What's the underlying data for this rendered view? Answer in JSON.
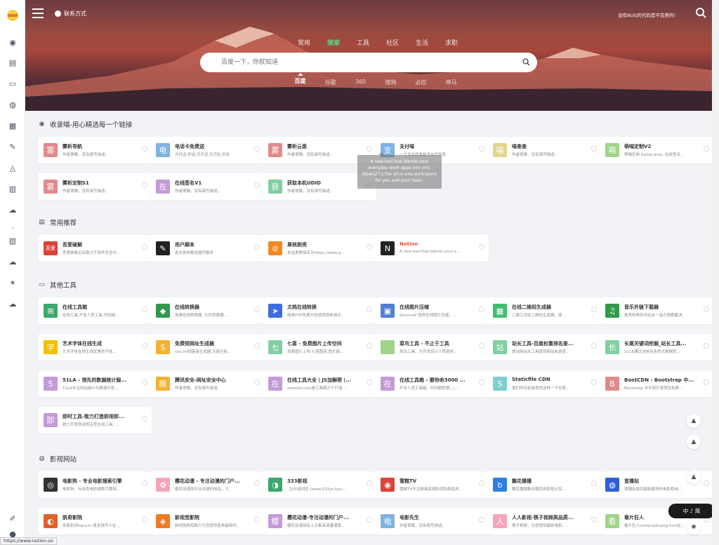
{
  "header": {
    "contact_label": "联系方式",
    "slogan": "没有BUG的代码是不完美的!",
    "search_tabs": [
      {
        "label": "常用",
        "active": false
      },
      {
        "label": "搜索",
        "active": true
      },
      {
        "label": "工具",
        "active": false
      },
      {
        "label": "社区",
        "active": false
      },
      {
        "label": "生活",
        "active": false
      },
      {
        "label": "求职",
        "active": false
      }
    ],
    "search_placeholder": "百度一下，你就知道",
    "engines": [
      {
        "label": "百度",
        "active": true
      },
      {
        "label": "谷歌",
        "active": false
      },
      {
        "label": "360",
        "active": false
      },
      {
        "label": "搜狗",
        "active": false
      },
      {
        "label": "必应",
        "active": false
      },
      {
        "label": "神马",
        "active": false
      }
    ]
  },
  "sections": [
    {
      "title": "收录喵-用心精选每一个链接",
      "icon": "eye-icon",
      "cards": [
        {
          "avatar": "雾",
          "color": "#e08a8a",
          "title": "雾析导航",
          "desc": "作者很懒，没有填写描述。"
        },
        {
          "avatar": "电",
          "color": "#7fb3e0",
          "title": "电话卡免费送",
          "desc": "次月返,秒返,月月返,次月反,秒反"
        },
        {
          "avatar": "雾",
          "color": "#e08a8a",
          "title": "雾析云盘",
          "desc": "作者很懒，没有填写描述。"
        },
        {
          "avatar": "支",
          "color": "#7fb3e0",
          "title": "支付喵",
          "desc": "一个专业的系统平台开发商"
        },
        {
          "avatar": "喵",
          "color": "#e3d58a",
          "title": "喵查查",
          "desc": "作者很懒，没有填写描述。"
        },
        {
          "avatar": "萌",
          "color": "#9fd48a",
          "title": "萌喵定制V2",
          "desc": "萌喵定制 &amp;amp; 在线签名..."
        },
        {
          "avatar": "雾",
          "color": "#e08a8a",
          "title": "雾析定制S1",
          "desc": "作者很懒，没有填写描述。"
        },
        {
          "avatar": "在",
          "color": "#c49ad8",
          "title": "在线签名V1",
          "desc": "作者很懒，没有填写描述。"
        },
        {
          "avatar": "获",
          "color": "#7fcfa0",
          "title": "获取本机UDID",
          "desc": "作者很懒，没有填写描述。"
        }
      ]
    },
    {
      "title": "常用推荐",
      "icon": "book-icon",
      "cards": [
        {
          "avatar": "吾爱",
          "color": "#d9443a",
          "title": "吾爱破解",
          "desc": "吾爱破解论坛致力于软件安全与..."
        },
        {
          "avatar": "✎",
          "color": "#222222",
          "title": "用户脚本",
          "desc": "各式各样精选插件脚本"
        },
        {
          "avatar": "⊘",
          "color": "#f08a24",
          "title": "果核剥壳",
          "desc": "本站更换域名为https://www.g..."
        },
        {
          "avatar": "N",
          "color": "#222222",
          "title": "Notion",
          "desc": "A new tool that blends your e..."
        }
      ]
    },
    {
      "title": "其他工具",
      "icon": "laptop-icon",
      "cards": [
        {
          "avatar": "⊞",
          "color": "#3aa86b",
          "title": "在线工具箱",
          "desc": "在线工具,开发人员工具,代码格..."
        },
        {
          "avatar": "◆",
          "color": "#2f9a4a",
          "title": "在线转换器",
          "desc": "免费在线转换器, 文件转换器, ..."
        },
        {
          "avatar": "➤",
          "color": "#3b6ee0",
          "title": "文档在线转换",
          "desc": "简单PDF免费为你提供简单强大..."
        },
        {
          "avatar": "▣",
          "color": "#4f7fd6",
          "title": "在线图片压缩",
          "desc": "docsmall 提供在线图片压缩、..."
        },
        {
          "avatar": "▦",
          "color": "#3fbf6f",
          "title": "在线二维码生成器",
          "desc": "二维工坊在二维码生成器，提..."
        },
        {
          "avatar": "♫",
          "color": "#2f9a4a",
          "title": "音乐外链下载器",
          "desc": "麦壳特帮你去站合一音乐搜索解决..."
        },
        {
          "avatar": "字",
          "color": "#f2c200",
          "title": "艺术字体在线生成",
          "desc": "艺术字体在线生成优美的字体..."
        },
        {
          "avatar": "S",
          "color": "#f2b233",
          "title": "免费短网址生成器",
          "desc": "suo.im短链接生成器,无需注册..."
        },
        {
          "avatar": "七",
          "color": "#7fcfa0",
          "title": "七喜 - 免费图片上传空间",
          "desc": "免费图片上传,七喜图床,图片链..."
        },
        {
          "avatar": "",
          "color": "#9fd48a",
          "title": "菜鸟工具 - 不止于工具",
          "desc": "菜鸟工具，为开发设计人员提供..."
        },
        {
          "avatar": "站",
          "color": "#7fcfa0",
          "title": "站长工具-百度权重排名查...",
          "desc": "爱站网站长工具提供网站收录查..."
        },
        {
          "avatar": "长",
          "color": "#7fcfa0",
          "title": "长尾关键词挖掘_站长工具...",
          "desc": "5118通过对排名各类大数据挖..."
        },
        {
          "avatar": "5",
          "color": "#c49ad8",
          "title": "51LA - 领先的数据统计服...",
          "desc": "51LA专注网站统计与数据分析..."
        },
        {
          "avatar": "腾",
          "color": "#f2b233",
          "title": "腾讯安全-网址安全中心",
          "desc": "作者很懒，没有填写描述。"
        },
        {
          "avatar": "在",
          "color": "#c49ad8",
          "title": "在线工具大全 | JS加解密 |...",
          "desc": "wetools.com是工具致力于打造..."
        },
        {
          "avatar": "在",
          "color": "#c49ad8",
          "title": "在线工具箱 - 要你命3000 ...",
          "desc": "开发人员工具箱，时间戳转换，j..."
        },
        {
          "avatar": "S",
          "color": "#7fcfcf",
          "title": "Staticfile CDN",
          "desc": "我们的目标是提供这样一个仓库..."
        },
        {
          "avatar": "B",
          "color": "#e08a8a",
          "title": "BootCDN - Bootstrap 中...",
          "desc": "Bootstrap 中文网开源项目免费..."
        },
        {
          "avatar": "即",
          "color": "#c49ad8",
          "title": "即时工具-致力打造即用即...",
          "desc": "致力开发即用即走型在线工具、..."
        }
      ]
    },
    {
      "title": "影视网站",
      "icon": "film-icon",
      "cards": [
        {
          "avatar": "◎",
          "color": "#333333",
          "title": "电影狗 - 专业电影搜索引擎",
          "desc": "电影狗，专业的电影搜索引擎网..."
        },
        {
          "avatar": "✿",
          "color": "#f4a6b8",
          "title": "樱花动漫 - 专注动漫的门户...",
          "desc": "樱花动漫网专业动漫的网站，于..."
        },
        {
          "avatar": "◑",
          "color": "#3aa86b",
          "title": "333影视",
          "desc": "【333影视】(www.333ys.fun)..."
        },
        {
          "avatar": "◉",
          "color": "#d9443a",
          "title": "雪糕TV",
          "desc": "雪糕TV专注极清高清影视免费高清..."
        },
        {
          "avatar": "b",
          "color": "#2f7fe0",
          "title": "飘花播播",
          "desc": "飘花播播集合飘花网影视分享..."
        },
        {
          "avatar": "◍",
          "color": "#2f5fd6",
          "title": "首播站",
          "desc": "首播站提供最新最快的电影和电..."
        },
        {
          "avatar": "◐",
          "color": "#e0602a",
          "title": "凯奇影院",
          "desc": "凯奇影视kqvy.tv-是全球华人在..."
        },
        {
          "avatar": "◈",
          "color": "#f07a24",
          "title": "新视觉影院",
          "desc": "新视觉影院致力为您提供各种最新的..."
        },
        {
          "avatar": "樱",
          "color": "#c49ad8",
          "title": "樱花动漫-专注动漫的门户...",
          "desc": "樱花动漫网有上万集高清番漫版..."
        },
        {
          "avatar": "电",
          "color": "#7fb3e0",
          "title": "电影先生",
          "desc": "作者很懒，没有填写描述。"
        },
        {
          "avatar": "人",
          "color": "#f4a6b8",
          "title": "人人影视-筷子视频高品质...",
          "desc": "筷子视频，为您提供最新电影、..."
        },
        {
          "avatar": "看",
          "color": "#9fd48a",
          "title": "看片狂人",
          "desc": "看片狂人(www.kpkuang.fun)在..."
        }
      ]
    }
  ],
  "tooltip": "A new tool that blends your everyday work apps into one. It&#x27;s the all-in-one workspace for you and your team.",
  "bubble_label": "中 ♪ 简",
  "status_url": "https://www.notion.so"
}
